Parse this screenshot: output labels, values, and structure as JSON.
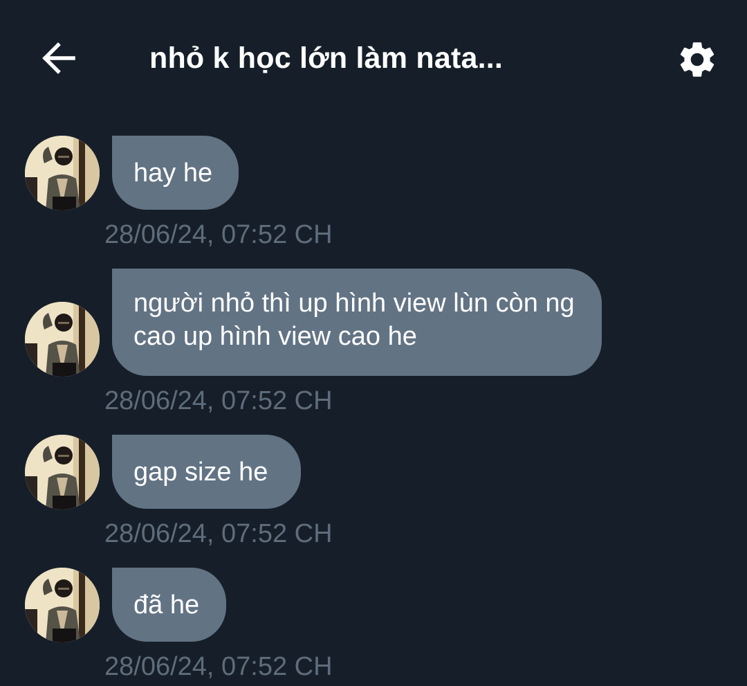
{
  "header": {
    "back_icon": "arrow-left-icon",
    "title": "nhỏ k học lớn làm nata...",
    "settings_icon": "gear-icon"
  },
  "messages": [
    {
      "text": "hay he",
      "timestamp": "28/06/24, 07:52 CH"
    },
    {
      "text": "người nhỏ thì up hình view lùn còn ng cao up hình view cao he",
      "timestamp": "28/06/24, 07:52 CH"
    },
    {
      "text": "gap size he",
      "timestamp": "28/06/24, 07:52 CH"
    },
    {
      "text": "đã he",
      "timestamp": "28/06/24, 07:52 CH"
    }
  ],
  "colors": {
    "background": "#161f29",
    "bubble": "#627384",
    "timestamp": "#5e6c7b",
    "text": "#ffffff"
  }
}
